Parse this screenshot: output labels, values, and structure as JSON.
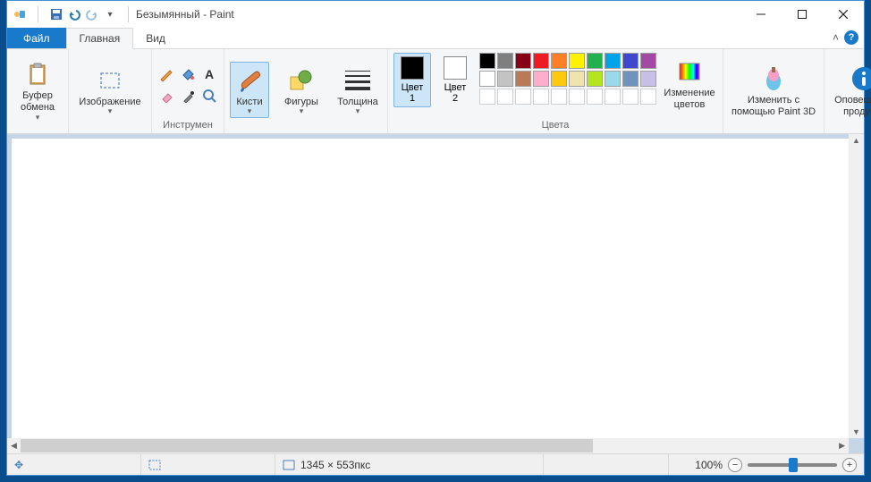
{
  "window": {
    "title": "Безымянный - Paint",
    "qat_dropdown": "▾"
  },
  "tabs": {
    "file": "Файл",
    "home": "Главная",
    "view": "Вид"
  },
  "ribbon": {
    "clipboard": {
      "button": "Буфер\nобмена",
      "label": ""
    },
    "image": {
      "button": "Изображение",
      "label": ""
    },
    "tools": {
      "label": "Инструмен"
    },
    "brushes": {
      "button": "Кисти"
    },
    "shapes": {
      "button": "Фигуры"
    },
    "thickness": {
      "button": "Толщина"
    },
    "color1": {
      "label": "Цвет\n1"
    },
    "color2": {
      "label": "Цвет\n2"
    },
    "editcolors": {
      "label": "Изменение\nцветов"
    },
    "paint3d": {
      "label": "Изменить с\nпомощью Paint 3D"
    },
    "notification": {
      "label": "Оповещение\nпродукта"
    },
    "colors_label": "Цвета",
    "palette": [
      [
        "#000000",
        "#7f7f7f",
        "#880015",
        "#ed1c24",
        "#ff7f27",
        "#fff200",
        "#22b14c",
        "#00a2e8",
        "#3f48cc",
        "#a349a4"
      ],
      [
        "#ffffff",
        "#c3c3c3",
        "#b97a57",
        "#ffaec9",
        "#ffc90e",
        "#efe4b0",
        "#b5e61d",
        "#99d9ea",
        "#7092be",
        "#c8bfe7"
      ]
    ],
    "current_color1": "#000000",
    "current_color2": "#ffffff"
  },
  "status": {
    "dimensions": "1345 × 553пкс",
    "zoom": "100%"
  }
}
